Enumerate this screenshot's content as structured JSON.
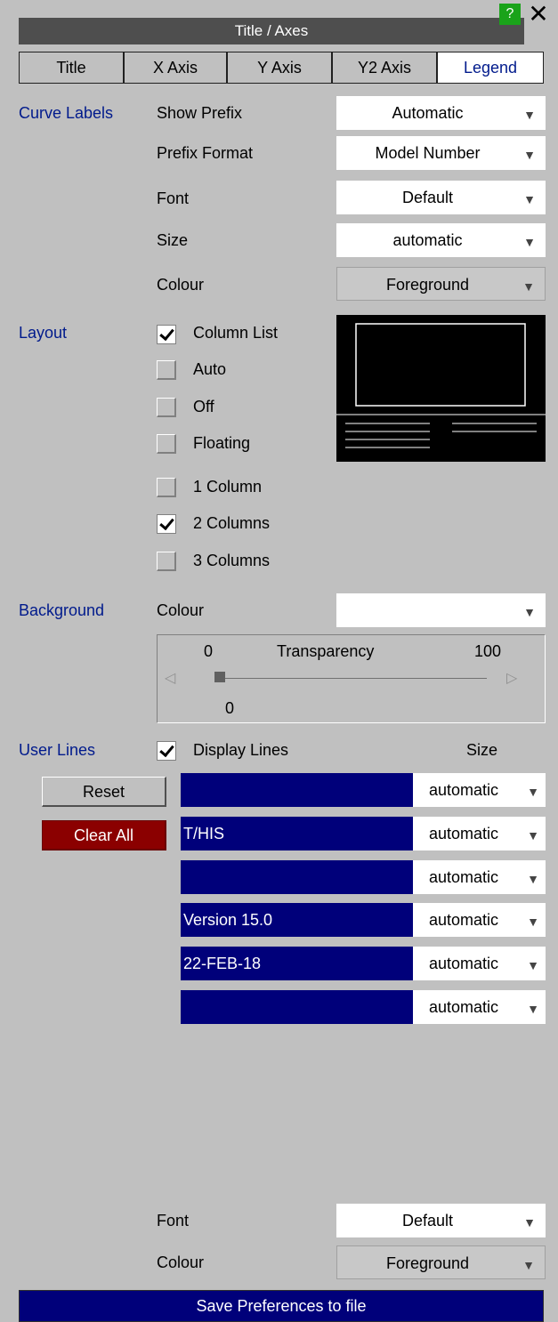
{
  "window": {
    "title": "Title / Axes",
    "help_label": "?",
    "close_label": "✕"
  },
  "tabs": [
    "Title",
    "X Axis",
    "Y Axis",
    "Y2 Axis",
    "Legend"
  ],
  "active_tab": "Legend",
  "curve_labels": {
    "section": "Curve Labels",
    "show_prefix_label": "Show Prefix",
    "show_prefix_value": "Automatic",
    "prefix_format_label": "Prefix Format",
    "prefix_format_value": "Model Number",
    "font_label": "Font",
    "font_value": "Default",
    "size_label": "Size",
    "size_value": "automatic",
    "colour_label": "Colour",
    "colour_value": "Foreground"
  },
  "layout": {
    "section": "Layout",
    "options": [
      {
        "label": "Column List",
        "checked": true
      },
      {
        "label": "Auto",
        "checked": false
      },
      {
        "label": "Off",
        "checked": false
      },
      {
        "label": "Floating",
        "checked": false
      }
    ],
    "columns": [
      {
        "label": "1 Column",
        "checked": false
      },
      {
        "label": "2 Columns",
        "checked": true
      },
      {
        "label": "3 Columns",
        "checked": false
      }
    ]
  },
  "background": {
    "section": "Background",
    "colour_label": "Colour",
    "colour_value": "",
    "transparency_label": "Transparency",
    "min": "0",
    "max": "100",
    "value": "0"
  },
  "user_lines": {
    "section": "User Lines",
    "display_label": "Display Lines",
    "display_checked": true,
    "size_header": "Size",
    "reset_label": "Reset",
    "clear_label": "Clear All",
    "lines": [
      {
        "text": "",
        "size": "automatic"
      },
      {
        "text": "T/HIS",
        "size": "automatic"
      },
      {
        "text": "",
        "size": "automatic"
      },
      {
        "text": "Version 15.0",
        "size": "automatic"
      },
      {
        "text": "22-FEB-18",
        "size": "automatic"
      },
      {
        "text": "",
        "size": "automatic"
      }
    ],
    "font_label": "Font",
    "font_value": "Default",
    "colour_label": "Colour",
    "colour_value": "Foreground"
  },
  "save_label": "Save Preferences to file",
  "icons": {
    "dropdown": "dropdown-arrow-icon",
    "check": "check-icon"
  }
}
